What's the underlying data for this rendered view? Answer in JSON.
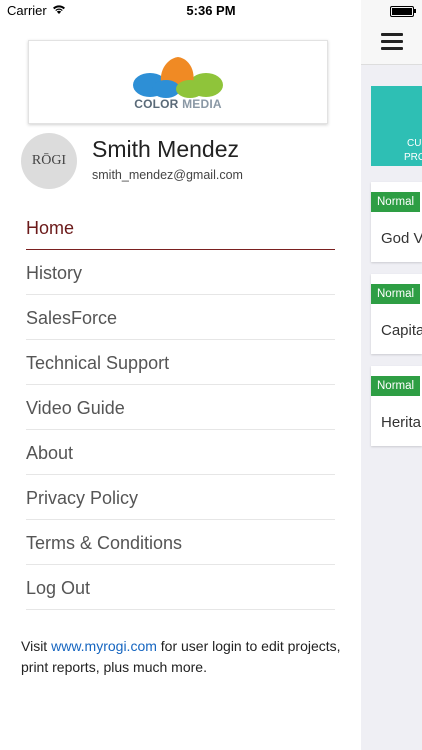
{
  "status_bar": {
    "carrier": "Carrier",
    "time": "5:36 PM"
  },
  "logo": {
    "text_bold": "COLOR",
    "text_light": " MEDIA"
  },
  "profile": {
    "avatar_text": "RŌGI",
    "name": "Smith Mendez",
    "email": "smith_mendez@gmail.com"
  },
  "menu": {
    "items": [
      {
        "label": "Home",
        "active": true
      },
      {
        "label": "History"
      },
      {
        "label": "SalesForce"
      },
      {
        "label": "Technical Support"
      },
      {
        "label": "Video Guide"
      },
      {
        "label": "About"
      },
      {
        "label": "Privacy Policy"
      },
      {
        "label": "Terms & Conditions"
      },
      {
        "label": "Log Out"
      }
    ]
  },
  "footer": {
    "prefix": "Visit ",
    "link": "www.myrogi.com",
    "suffix": " for user login to edit projects,  print reports, plus much more."
  },
  "right_panel": {
    "teal_card": {
      "line1": "CU",
      "line2": "PRO"
    },
    "cards": [
      {
        "badge": "Normal",
        "title": "God V"
      },
      {
        "badge": "Normal",
        "title": "Capita"
      },
      {
        "badge": "Normal",
        "title": "Herita"
      }
    ]
  },
  "colors": {
    "accent_active": "#7a2020",
    "teal": "#2ebfb4",
    "badge_green": "#2e9e44",
    "link_blue": "#1565c0"
  },
  "icons": [
    "wifi-icon",
    "battery-icon",
    "hamburger-menu-icon"
  ]
}
